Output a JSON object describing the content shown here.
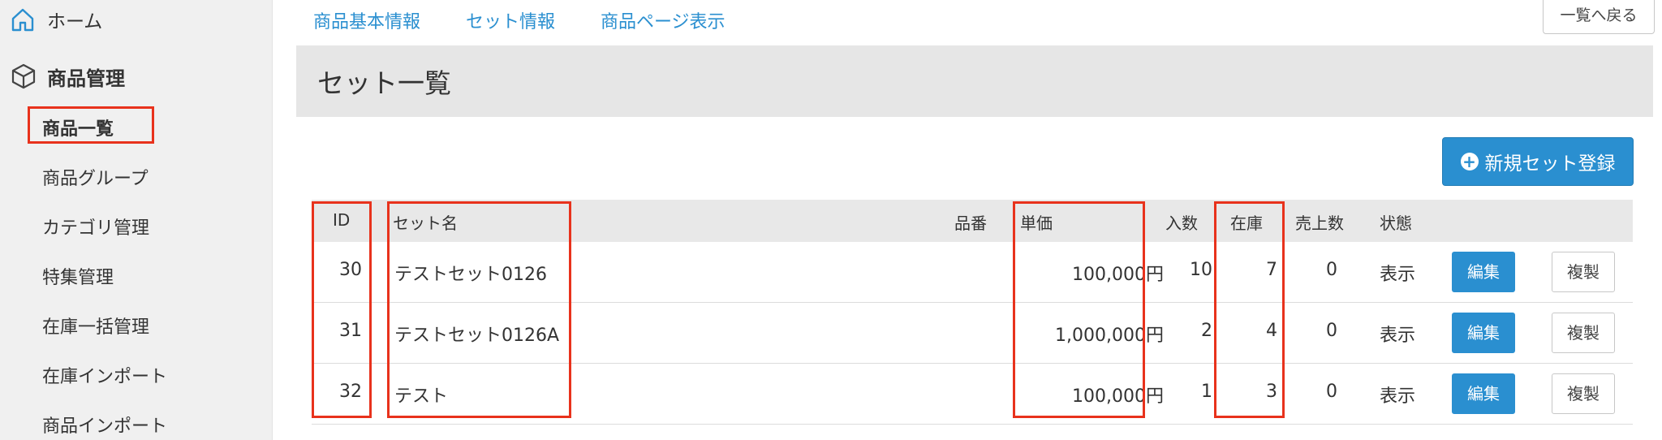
{
  "sidebar": {
    "home_label": "ホーム",
    "products_label": "商品管理",
    "items": [
      {
        "label": "商品一覧",
        "active": true
      },
      {
        "label": "商品グループ"
      },
      {
        "label": "カテゴリ管理"
      },
      {
        "label": "特集管理"
      },
      {
        "label": "在庫一括管理"
      },
      {
        "label": "在庫インポート"
      },
      {
        "label": "商品インポート"
      }
    ]
  },
  "top_tabs": [
    "商品基本情報",
    "セット情報",
    "商品ページ表示"
  ],
  "back_label": "一覧へ戻る",
  "panel": {
    "title": "セット一覧",
    "new_button_label": "新規セット登録"
  },
  "table": {
    "headers": {
      "id": "ID",
      "name": "セット名",
      "code": "品番",
      "price": "単価",
      "qty": "入数",
      "stock": "在庫",
      "sold": "売上数",
      "status": "状態"
    },
    "rows": [
      {
        "id": "30",
        "name": "テストセット0126",
        "code": "",
        "price": "100,000円",
        "qty": "10",
        "stock": "7",
        "sold": "0",
        "status": "表示",
        "edit": "編集",
        "copy": "複製"
      },
      {
        "id": "31",
        "name": "テストセット0126A",
        "code": "",
        "price": "1,000,000円",
        "qty": "2",
        "stock": "4",
        "sold": "0",
        "status": "表示",
        "edit": "編集",
        "copy": "複製"
      },
      {
        "id": "32",
        "name": "テスト",
        "code": "",
        "price": "100,000円",
        "qty": "1",
        "stock": "3",
        "sold": "0",
        "status": "表示",
        "edit": "編集",
        "copy": "複製"
      }
    ]
  },
  "colors": {
    "accent": "#2a8fd0",
    "highlight": "#e8321c",
    "sidebar_bg": "#f0f0f0",
    "header_bg": "#e6e6e6"
  }
}
